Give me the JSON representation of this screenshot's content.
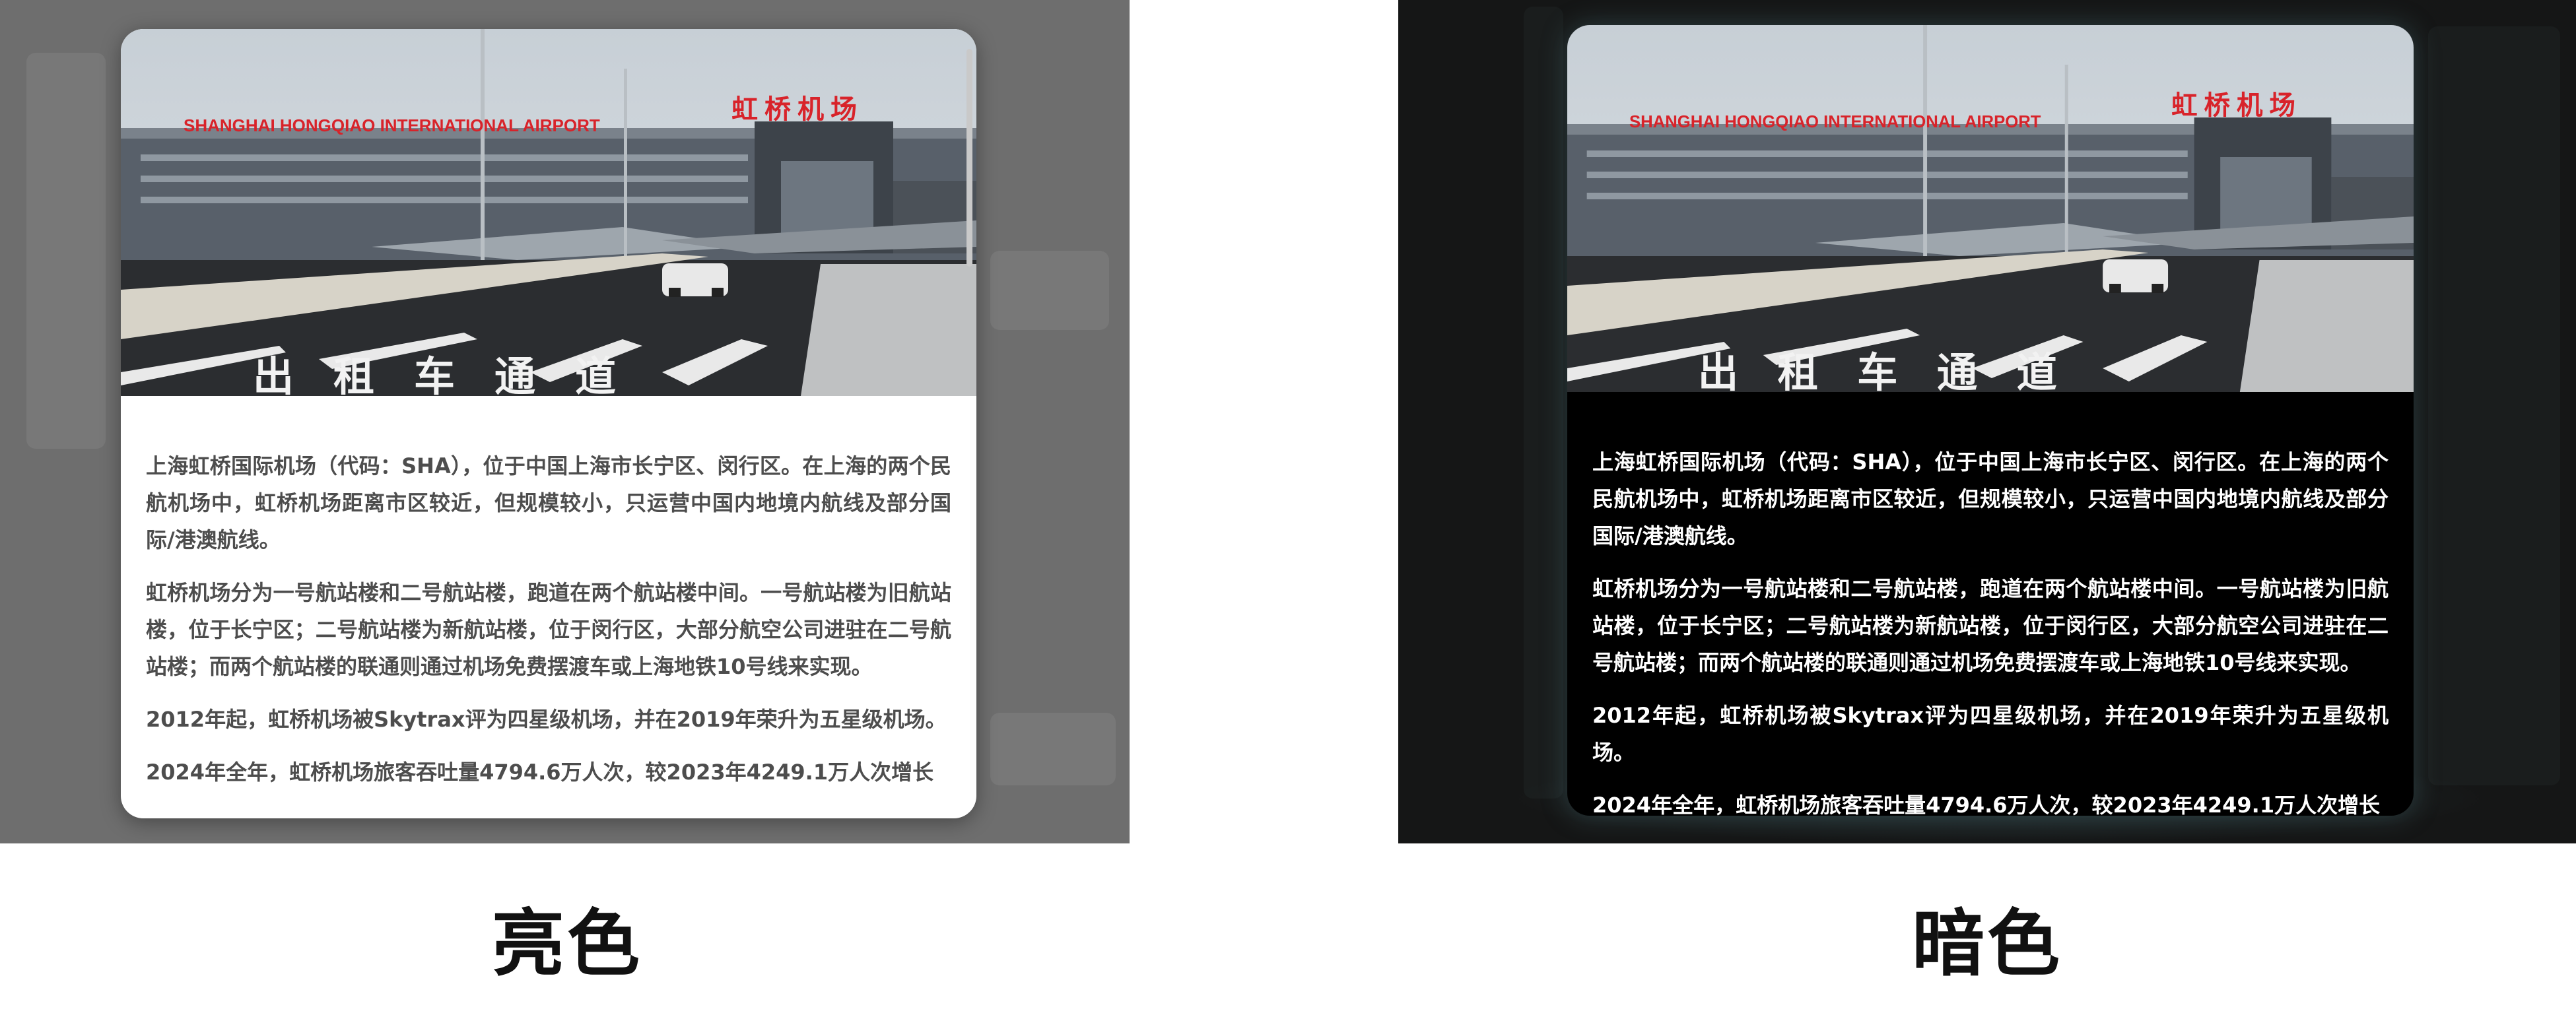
{
  "panels": [
    {
      "id": "light",
      "caption": "亮色",
      "card": {
        "hero": {
          "sign_text": "SHANGHAI  HONGQIAO  INTERNATIONAL  AIRPORT",
          "sign_cn": "虹桥机场",
          "road_text": "出租车通道"
        },
        "paragraphs": [
          "上海虹桥国际机场（代码：SHA），位于中国上海市长宁区、闵行区。在上海的两个民航机场中，虹桥机场距离市区较近，但规模较小，只运营中国内地境内航线及部分国际/港澳航线。",
          "虹桥机场分为一号航站楼和二号航站楼，跑道在两个航站楼中间。一号航站楼为旧航站楼，位于长宁区；二号航站楼为新航站楼，位于闵行区，大部分航空公司进驻在二号航站楼；而两个航站楼的联通则通过机场免费摆渡车或上海地铁10号线来实现。",
          "2012年起，虹桥机场被Skytrax评为四星级机场，并在2019年荣升为五星级机场。",
          "2024年全年，虹桥机场旅客吞吐量4794.6万人次，较2023年4249.1万人次增长"
        ]
      }
    },
    {
      "id": "dark",
      "caption": "暗色",
      "card": {
        "hero": {
          "sign_text": "SHANGHAI  HONGQIAO  INTERNATIONAL  AIRPORT",
          "sign_cn": "虹桥机场",
          "road_text": "出租车通道"
        },
        "paragraphs": [
          "上海虹桥国际机场（代码：SHA），位于中国上海市长宁区、闵行区。在上海的两个民航机场中，虹桥机场距离市区较近，但规模较小，只运营中国内地境内航线及部分国际/港澳航线。",
          "虹桥机场分为一号航站楼和二号航站楼，跑道在两个航站楼中间。一号航站楼为旧航站楼，位于长宁区；二号航站楼为新航站楼，位于闵行区，大部分航空公司进驻在二号航站楼；而两个航站楼的联通则通过机场免费摆渡车或上海地铁10号线来实现。",
          "2012年起，虹桥机场被Skytrax评为四星级机场，并在2019年荣升为五星级机场。",
          "2024年全年，虹桥机场旅客吞吐量4794.6万人次，较2023年4249.1万人次增长"
        ]
      }
    }
  ],
  "colors": {
    "light_backdrop": "#6e6e6e",
    "dark_backdrop": "#151616",
    "light_text": "#4d4d4d",
    "dark_text": "#ffffff",
    "sign_red": "#d8232a"
  }
}
